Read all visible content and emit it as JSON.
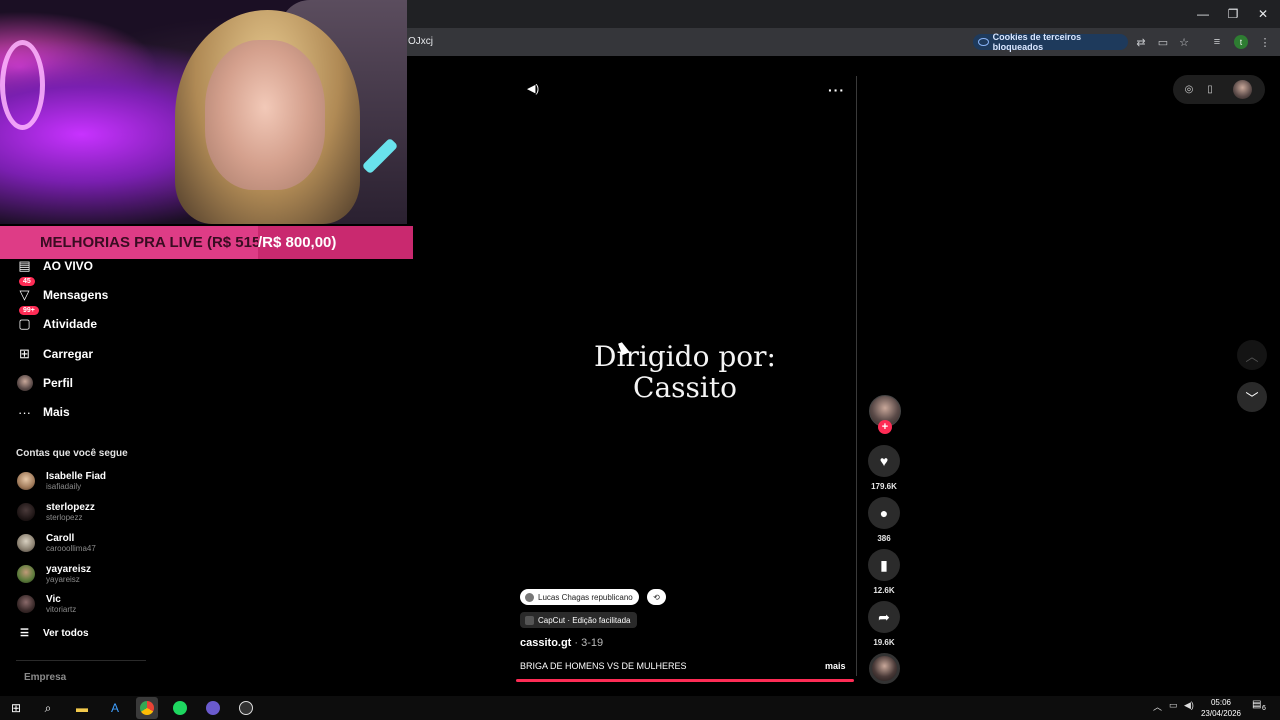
{
  "browser": {
    "url_fragment": "OJxcj",
    "cookie_chip_label": "Cookies de terceiros bloqueados",
    "profile_initial": "t",
    "window_controls": [
      "—",
      "❐",
      "✕"
    ]
  },
  "stream_overlay": {
    "goal_text_left": "MELHORIAS PRA LIVE (R$ 515,00",
    "goal_text_right": "/R$ 800,00)"
  },
  "sidebar": {
    "items": [
      {
        "label": "AO VIVO",
        "icon": "live-icon"
      },
      {
        "label": "Mensagens",
        "icon": "messages-icon",
        "badge": "45"
      },
      {
        "label": "Atividade",
        "icon": "activity-icon",
        "badge": "99+"
      },
      {
        "label": "Carregar",
        "icon": "upload-icon"
      },
      {
        "label": "Perfil",
        "icon": "profile-avatar"
      },
      {
        "label": "Mais",
        "icon": "more-icon"
      }
    ],
    "following_title": "Contas que você segue",
    "following": [
      {
        "name": "Isabelle Fiad",
        "handle": "isafiadaily"
      },
      {
        "name": "sterlopezz",
        "handle": "sterlopezz"
      },
      {
        "name": "Caroll",
        "handle": "carooollima47"
      },
      {
        "name": "yayareisz",
        "handle": "yayareisz"
      },
      {
        "name": "Vic",
        "handle": "vitoriartz"
      }
    ],
    "see_all": "Ver todos",
    "company": "Empresa"
  },
  "video": {
    "caption_line1": "Dirigido por:",
    "caption_line2": "Cassito",
    "repost_chip": "Lucas Chagas republicano",
    "capcut_chip": "CapCut · Edição facilitada",
    "author": "cassito.gt",
    "date": " · 3-19",
    "description": "BRIGA DE HOMENS VS DE MULHERES",
    "more": "mais",
    "progress": 1.0
  },
  "actions": {
    "likes": "179.6K",
    "comments": "386",
    "saves": "12.6K",
    "shares": "19.6K"
  },
  "taskbar": {
    "time": "05:06",
    "date": "23/04/2026",
    "notifications": "6"
  },
  "colors": {
    "accent": "#fe2c55",
    "overlay_banner": "#de3c86"
  }
}
